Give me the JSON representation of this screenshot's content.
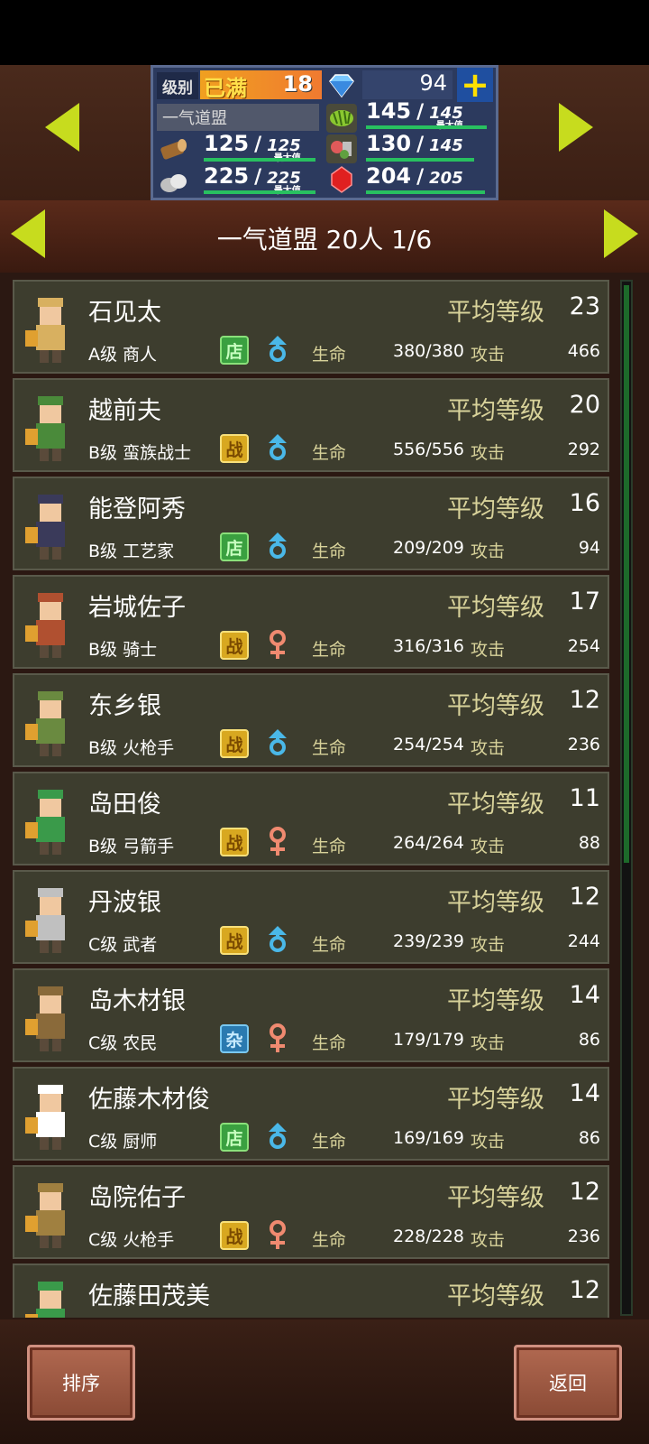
{
  "top": {
    "level_label": "级别",
    "level_status": "已满",
    "level_value": "18",
    "gems": "94",
    "plus_symbol": "+",
    "guild_name": "一气道盟",
    "max_note": "最大值",
    "resources": [
      {
        "name": "wood",
        "value": "125",
        "max": "125"
      },
      {
        "name": "grass",
        "value": "145",
        "max": "145"
      },
      {
        "name": "stone",
        "value": "225",
        "max": "225"
      },
      {
        "name": "food",
        "value": "130",
        "max": "145"
      },
      {
        "name": "ruby",
        "value": "204",
        "max": "205"
      }
    ]
  },
  "header": {
    "title": "一气道盟  20人 1/6"
  },
  "labels": {
    "avg_level": "平均等级",
    "hp": "生命",
    "atk": "攻击"
  },
  "members": [
    {
      "name": "石见太",
      "level": "23",
      "job": "A级 商人",
      "badge": "店",
      "badge_type": "shop",
      "gender": "male",
      "hp": "380/380",
      "atk": "466"
    },
    {
      "name": "越前夫",
      "level": "20",
      "job": "B级 蛮族战士",
      "badge": "战",
      "badge_type": "war",
      "gender": "male",
      "hp": "556/556",
      "atk": "292"
    },
    {
      "name": "能登阿秀",
      "level": "16",
      "job": "B级 工艺家",
      "badge": "店",
      "badge_type": "shop",
      "gender": "male",
      "hp": "209/209",
      "atk": "94"
    },
    {
      "name": "岩城佐子",
      "level": "17",
      "job": "B级 骑士",
      "badge": "战",
      "badge_type": "war",
      "gender": "female",
      "hp": "316/316",
      "atk": "254"
    },
    {
      "name": "东乡银",
      "level": "12",
      "job": "B级 火枪手",
      "badge": "战",
      "badge_type": "war",
      "gender": "male",
      "hp": "254/254",
      "atk": "236"
    },
    {
      "name": "岛田俊",
      "level": "11",
      "job": "B级 弓箭手",
      "badge": "战",
      "badge_type": "war",
      "gender": "female",
      "hp": "264/264",
      "atk": "88"
    },
    {
      "name": "丹波银",
      "level": "12",
      "job": "C级 武者",
      "badge": "战",
      "badge_type": "war",
      "gender": "male",
      "hp": "239/239",
      "atk": "244"
    },
    {
      "name": "岛木材银",
      "level": "14",
      "job": "C级 农民",
      "badge": "杂",
      "badge_type": "misc",
      "gender": "female",
      "hp": "179/179",
      "atk": "86"
    },
    {
      "name": "佐藤木材俊",
      "level": "14",
      "job": "C级 厨师",
      "badge": "店",
      "badge_type": "shop",
      "gender": "male",
      "hp": "169/169",
      "atk": "86"
    },
    {
      "name": "岛院佑子",
      "level": "12",
      "job": "C级 火枪手",
      "badge": "战",
      "badge_type": "war",
      "gender": "female",
      "hp": "228/228",
      "atk": "236"
    },
    {
      "name": "佐藤田茂美",
      "level": "12",
      "job": "",
      "badge": "",
      "badge_type": "",
      "gender": "",
      "hp": "",
      "atk": ""
    }
  ],
  "buttons": {
    "sort": "排序",
    "back": "返回"
  },
  "colors": {
    "arrow": "#c7dc1e",
    "card_bg": "#3d3d2e",
    "avg_label": "#d8d29a",
    "male": "#4ab8e8",
    "female": "#f08a70"
  }
}
